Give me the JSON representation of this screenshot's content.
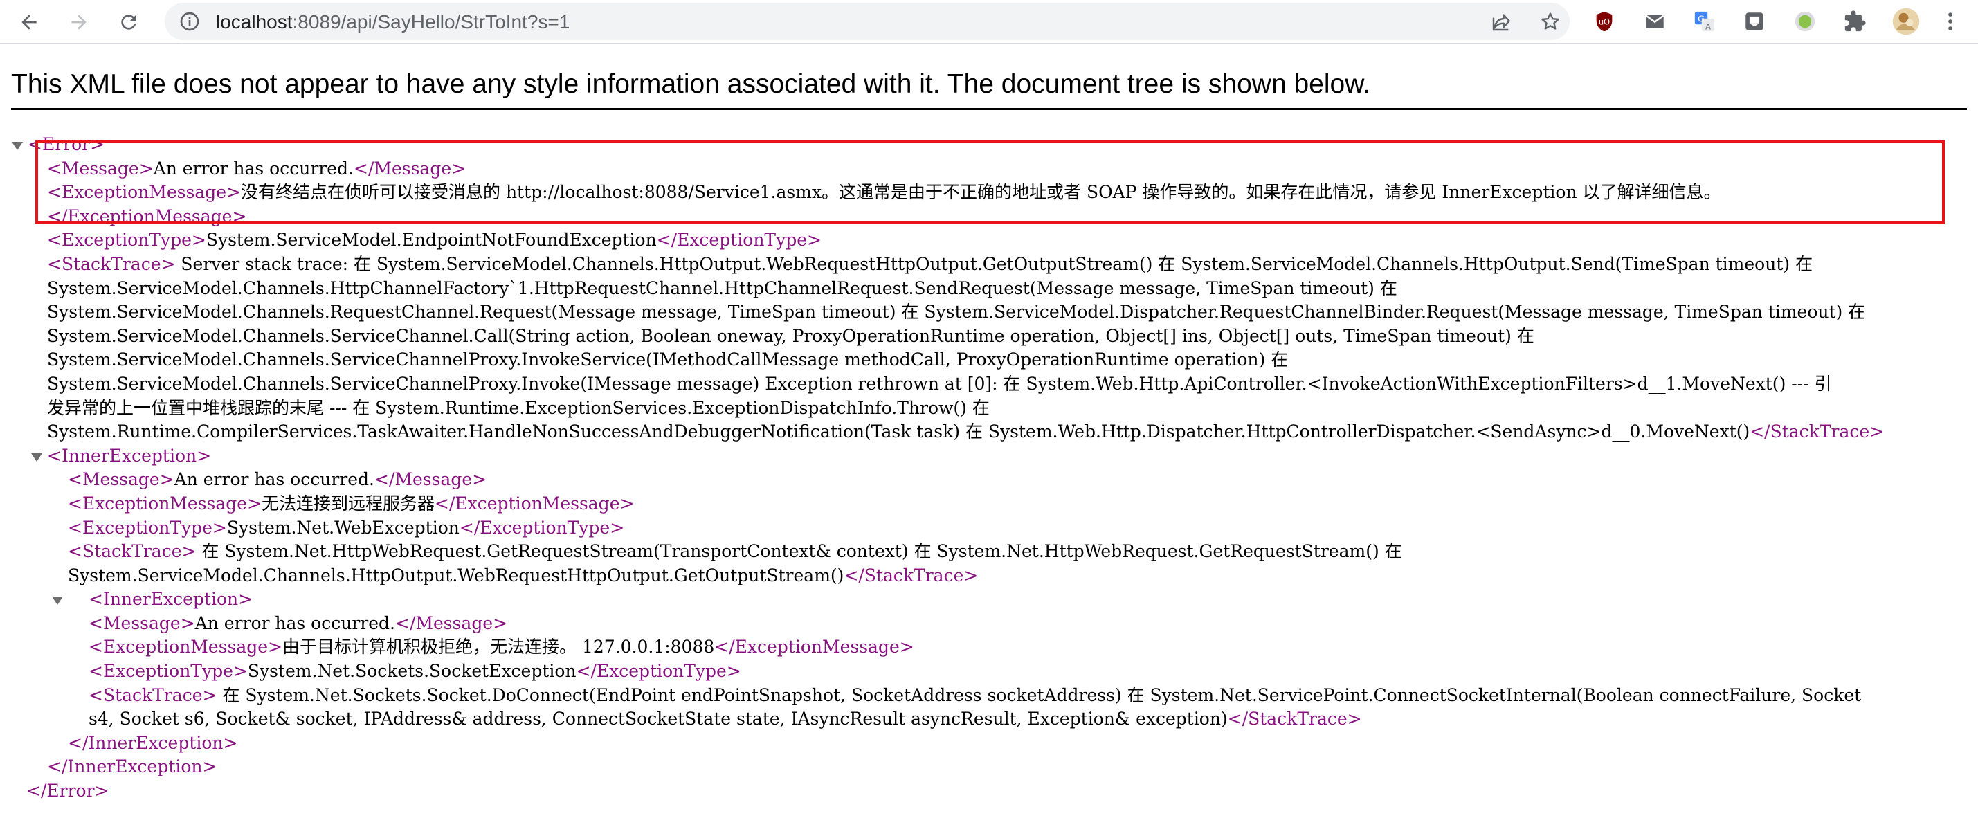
{
  "browser": {
    "url_host": "localhost",
    "url_rest": ":8089/api/SayHello/StrToInt?s=1"
  },
  "icons": {
    "back": "back-arrow-icon",
    "forward": "forward-arrow-icon",
    "reload": "reload-icon",
    "site_info": "info-icon",
    "share": "share-icon",
    "bookmark": "star-icon",
    "extensions": [
      "ublock-icon",
      "mail-icon",
      "translate-icon",
      "extension-box-icon",
      "circle-extension-icon",
      "puzzle-icon",
      "avatar",
      "kebab-menu-icon"
    ]
  },
  "colors": {
    "tag": "#881280",
    "highlight": "#e8141a"
  },
  "xml": {
    "notice": "This XML file does not appear to have any style information associated with it. The document tree is shown below.",
    "lines": [
      {
        "o": "<Error>",
        "t": "",
        "c": ""
      },
      {
        "o": "<Message>",
        "t": "An error has occurred.",
        "c": "</Message>"
      },
      {
        "o": "<ExceptionMessage>",
        "t": "没有终结点在侦听可以接受消息的 http://localhost:8088/Service1.asmx。这通常是由于不正确的地址或者 SOAP 操作导致的。如果存在此情况，请参见 InnerException 以了解详细信息。",
        "c": ""
      },
      {
        "o": "",
        "t": "",
        "c": "</ExceptionMessage>"
      },
      {
        "o": "<ExceptionType>",
        "t": "System.ServiceModel.EndpointNotFoundException",
        "c": "</ExceptionType>"
      },
      {
        "o": "<StackTrace>",
        "t": " Server stack trace: 在 System.ServiceModel.Channels.HttpOutput.WebRequestHttpOutput.GetOutputStream() 在 System.ServiceModel.Channels.HttpOutput.Send(TimeSpan timeout) 在",
        "c": ""
      },
      {
        "o": "",
        "t": "System.ServiceModel.Channels.HttpChannelFactory`1.HttpRequestChannel.HttpChannelRequest.SendRequest(Message message, TimeSpan timeout) 在",
        "c": ""
      },
      {
        "o": "",
        "t": "System.ServiceModel.Channels.RequestChannel.Request(Message message, TimeSpan timeout) 在 System.ServiceModel.Dispatcher.RequestChannelBinder.Request(Message message, TimeSpan timeout) 在",
        "c": ""
      },
      {
        "o": "",
        "t": "System.ServiceModel.Channels.ServiceChannel.Call(String action, Boolean oneway, ProxyOperationRuntime operation, Object[] ins, Object[] outs, TimeSpan timeout) 在",
        "c": ""
      },
      {
        "o": "",
        "t": "System.ServiceModel.Channels.ServiceChannelProxy.InvokeService(IMethodCallMessage methodCall, ProxyOperationRuntime operation) 在",
        "c": ""
      },
      {
        "o": "",
        "t": "System.ServiceModel.Channels.ServiceChannelProxy.Invoke(IMessage message) Exception rethrown at [0]: 在 System.Web.Http.ApiController.<InvokeActionWithExceptionFilters>d__1.MoveNext() --- 引",
        "c": ""
      },
      {
        "o": "",
        "t": "发异常的上一位置中堆栈跟踪的末尾 --- 在 System.Runtime.ExceptionServices.ExceptionDispatchInfo.Throw() 在",
        "c": ""
      },
      {
        "o": "",
        "t": "System.Runtime.CompilerServices.TaskAwaiter.HandleNonSuccessAndDebuggerNotification(Task task) 在 System.Web.Http.Dispatcher.HttpControllerDispatcher.<SendAsync>d__0.MoveNext()",
        "c": "</StackTrace>"
      },
      {
        "o": "<InnerException>",
        "t": "",
        "c": ""
      },
      {
        "o": "<Message>",
        "t": "An error has occurred.",
        "c": "</Message>"
      },
      {
        "o": "<ExceptionMessage>",
        "t": "无法连接到远程服务器",
        "c": "</ExceptionMessage>"
      },
      {
        "o": "<ExceptionType>",
        "t": "System.Net.WebException",
        "c": "</ExceptionType>"
      },
      {
        "o": "<StackTrace>",
        "t": " 在 System.Net.HttpWebRequest.GetRequestStream(TransportContext& context) 在 System.Net.HttpWebRequest.GetRequestStream() 在",
        "c": ""
      },
      {
        "o": "",
        "t": "System.ServiceModel.Channels.HttpOutput.WebRequestHttpOutput.GetOutputStream()",
        "c": "</StackTrace>"
      },
      {
        "o": "<InnerException>",
        "t": "",
        "c": ""
      },
      {
        "o": "<Message>",
        "t": "An error has occurred.",
        "c": "</Message>"
      },
      {
        "o": "<ExceptionMessage>",
        "t": "由于目标计算机积极拒绝，无法连接。 127.0.0.1:8088",
        "c": "</ExceptionMessage>"
      },
      {
        "o": "<ExceptionType>",
        "t": "System.Net.Sockets.SocketException",
        "c": "</ExceptionType>"
      },
      {
        "o": "<StackTrace>",
        "t": " 在 System.Net.Sockets.Socket.DoConnect(EndPoint endPointSnapshot, SocketAddress socketAddress) 在 System.Net.ServicePoint.ConnectSocketInternal(Boolean connectFailure, Socket",
        "c": ""
      },
      {
        "o": "",
        "t": "s4, Socket s6, Socket& socket, IPAddress& address, ConnectSocketState state, IAsyncResult asyncResult, Exception& exception)",
        "c": "</StackTrace>"
      },
      {
        "o": "",
        "t": "",
        "c": "</InnerException>"
      },
      {
        "o": "",
        "t": "",
        "c": "</InnerException>"
      },
      {
        "o": "",
        "t": "",
        "c": "</Error>"
      }
    ]
  }
}
